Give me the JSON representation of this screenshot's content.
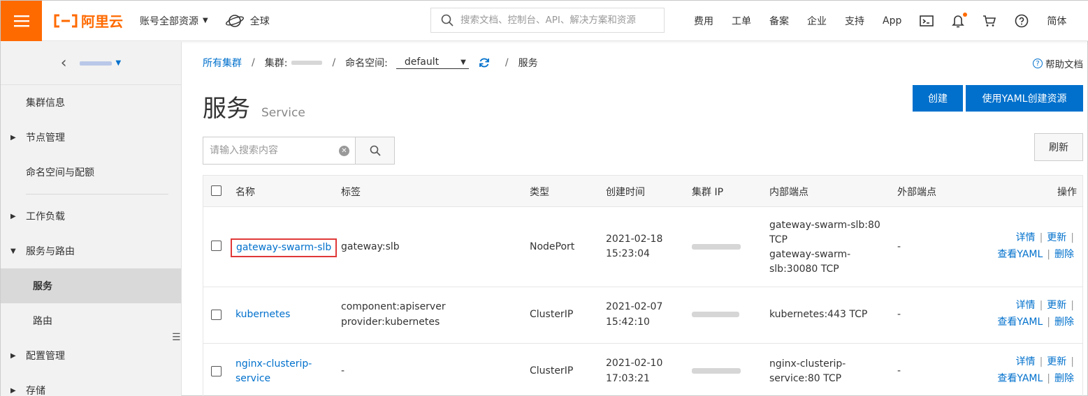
{
  "topbar": {
    "brand": "阿里云",
    "account_label": "账号全部资源",
    "region_label": "全球",
    "search_placeholder": "搜索文档、控制台、API、解决方案和资源",
    "nav": [
      "费用",
      "工单",
      "备案",
      "企业",
      "支持",
      "App"
    ],
    "lang": "简体",
    "accent_color": "#ff6a00"
  },
  "sidebar": {
    "items": [
      {
        "label": "集群信息",
        "type": "item"
      },
      {
        "label": "节点管理",
        "type": "group"
      },
      {
        "label": "命名空间与配额",
        "type": "item"
      },
      {
        "label": "工作负载",
        "type": "group"
      },
      {
        "label": "服务与路由",
        "type": "group-open"
      },
      {
        "label": "服务",
        "type": "sub-active"
      },
      {
        "label": "路由",
        "type": "sub"
      },
      {
        "label": "配置管理",
        "type": "group"
      },
      {
        "label": "存储",
        "type": "group"
      }
    ]
  },
  "breadcrumb": {
    "all_clusters": "所有集群",
    "cluster_label": "集群:",
    "namespace_label": "命名空间:",
    "namespace_value": "default",
    "current": "服务"
  },
  "help_doc": "帮助文档",
  "page": {
    "title": "服务",
    "subtitle": "Service",
    "create_button": "创建",
    "yaml_button": "使用YAML创建资源",
    "search_placeholder": "请输入搜索内容",
    "refresh_button": "刷新"
  },
  "table": {
    "headers": {
      "name": "名称",
      "labels": "标签",
      "type": "类型",
      "created": "创建时间",
      "cluster_ip": "集群 IP",
      "internal_endpoints": "内部端点",
      "external_endpoints": "外部端点",
      "actions": "操作"
    },
    "actions": {
      "detail": "详情",
      "update": "更新",
      "view_yaml": "查看YAML",
      "delete": "删除"
    },
    "rows": [
      {
        "name": "gateway-swarm-slb",
        "labels": [
          "gateway:slb"
        ],
        "type": "NodePort",
        "created_date": "2021-02-18",
        "created_time": "15:23:04",
        "internal": [
          "gateway-swarm-slb:80",
          "TCP",
          "gateway-swarm-",
          "slb:30080 TCP"
        ],
        "external": "-"
      },
      {
        "name": "kubernetes",
        "labels": [
          "component:apiserver",
          "provider:kubernetes"
        ],
        "type": "ClusterIP",
        "created_date": "2021-02-07",
        "created_time": "15:42:10",
        "internal": [
          "kubernetes:443 TCP"
        ],
        "external": "-"
      },
      {
        "name_lines": [
          "nginx-clusterip-",
          "service"
        ],
        "labels": [
          "-"
        ],
        "type": "ClusterIP",
        "created_date": "2021-02-10",
        "created_time": "17:03:21",
        "internal": [
          "nginx-clusterip-",
          "service:80 TCP"
        ],
        "external": "-"
      }
    ]
  }
}
